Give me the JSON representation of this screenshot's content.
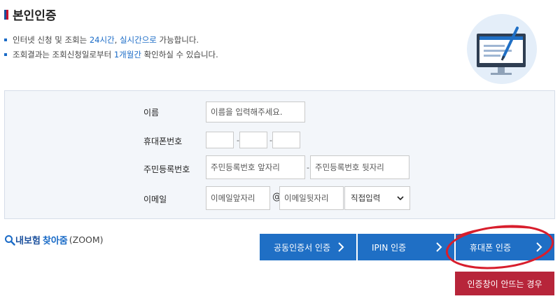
{
  "title": "본인인증",
  "notices": [
    {
      "pre": "인터넷 신청 및 조회는 ",
      "hl1": "24시간",
      "mid": ", ",
      "hl2": "실시간으로",
      "post": " 가능합니다."
    },
    {
      "pre": "조회결과는 조회신청일로부터 ",
      "hl1": "1개월간",
      "mid": "",
      "hl2": "",
      "post": " 확인하실 수 있습니다."
    }
  ],
  "form": {
    "name_label": "이름",
    "name_placeholder": "이름을 입력해주세요.",
    "phone_label": "휴대폰번호",
    "phone_dash": "-",
    "rrn_label": "주민등록번호",
    "rrn_front_placeholder": "주민등록번호 앞자리",
    "rrn_back_placeholder": "주민등록번호 뒷자리",
    "rrn_dash": "-",
    "email_label": "이메일",
    "email_front_placeholder": "이메일앞자리",
    "email_at": "@",
    "email_back_placeholder": "이메일뒷자리",
    "email_select": "직접입력"
  },
  "zoom": {
    "part1": "내보험",
    "part2": "찾아줌",
    "part3": "(ZOOM)"
  },
  "buttons": {
    "cert": "공동인증서 인증",
    "ipin": "IPIN 인증",
    "phone": "휴대폰 인증",
    "help": "인증창이 안뜨는 경우"
  },
  "colors": {
    "accent": "#1f6fc5",
    "help_button": "#b7253a",
    "highlight": "#1a6bc7",
    "annotation": "#d81e2c"
  },
  "icons": [
    "search-icon",
    "chevron-right-icon",
    "monitor-illustration"
  ]
}
